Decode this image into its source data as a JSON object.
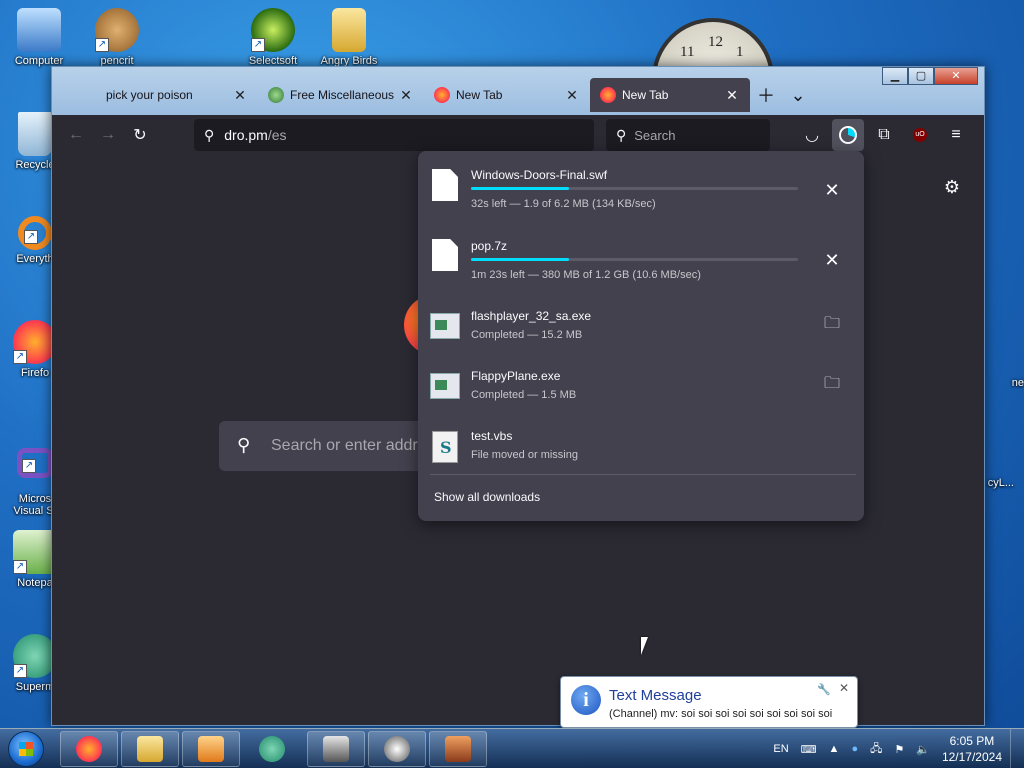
{
  "desktop": {
    "icons": [
      {
        "label": "Computer",
        "icon": "computer-icon",
        "color": "#5aa0e0"
      },
      {
        "label": "Recycle",
        "icon": "recycle-bin-icon",
        "color": "#9fc6e8"
      },
      {
        "label": "Everyth",
        "icon": "everything-search-icon",
        "color": "#f08a20"
      },
      {
        "label": "Firefo",
        "icon": "firefox-icon",
        "color": "#ff6a2a"
      },
      {
        "label": "Micros\nVisual St",
        "icon": "visual-studio-icon",
        "color": "#5a3fa0"
      },
      {
        "label": "Notepa",
        "icon": "notepad-icon",
        "color": "#6ab04a"
      },
      {
        "label": "Superm",
        "icon": "supermium-icon",
        "color": "#2a9a7a"
      },
      {
        "label": "pencrit",
        "icon": "monkey-icon",
        "color": "#b8843c"
      },
      {
        "label": "Selectsoft",
        "icon": "selectsoft-icon",
        "color": "#7ab82a"
      },
      {
        "label": "Angry Birds",
        "icon": "folder-icon",
        "color": "#e8c84a"
      }
    ],
    "right_icons": [
      {
        "label": "ne",
        "icon": "app-icon"
      },
      {
        "label": "cyL...",
        "icon": "app-icon"
      }
    ]
  },
  "browser": {
    "tabs": [
      {
        "title": "pick your poison",
        "favicon": "none",
        "active": false
      },
      {
        "title": "Free Miscellaneous S",
        "favicon": "globe-icon",
        "active": false
      },
      {
        "title": "New Tab",
        "favicon": "firefox-icon",
        "active": false
      },
      {
        "title": "New Tab",
        "favicon": "firefox-icon",
        "active": true
      }
    ],
    "url": {
      "host": "dro.pm",
      "path": "/es"
    },
    "search_placeholder": "Search",
    "newtab_search_placeholder": "Search or enter addres",
    "accent_color": "#00ddff"
  },
  "downloads": {
    "items": [
      {
        "name": "Windows-Doors-Final.swf",
        "status": "32s left — 1.9 of 6.2 MB (134 KB/sec)",
        "progress": 0.3,
        "state": "downloading",
        "icon": "document-icon",
        "action": "cancel-icon"
      },
      {
        "name": "pop.7z",
        "status": "1m 23s left — 380 MB of 1.2 GB (10.6 MB/sec)",
        "progress": 0.3,
        "state": "downloading",
        "icon": "document-icon",
        "action": "cancel-icon"
      },
      {
        "name": "flashplayer_32_sa.exe",
        "status": "Completed — 15.2 MB",
        "progress": 1.0,
        "state": "completed",
        "icon": "exe-icon",
        "action": "folder-icon"
      },
      {
        "name": "FlappyPlane.exe",
        "status": "Completed — 1.5 MB",
        "progress": 1.0,
        "state": "completed",
        "icon": "exe-icon",
        "action": "folder-icon"
      },
      {
        "name": "test.vbs",
        "status": "File moved or missing",
        "progress": 0,
        "state": "missing",
        "icon": "vbs-script-icon",
        "action": "none"
      }
    ],
    "show_all_label": "Show all downloads"
  },
  "notification": {
    "title": "Text Message",
    "body": "(Channel) mv: soi soi soi soi soi soi soi soi soi"
  },
  "taskbar": {
    "apps": [
      "firefox-icon",
      "explorer-folder-icon",
      "media-player-icon",
      "supermium-icon",
      "chess-icon",
      "ble-icon",
      "game-icon"
    ],
    "language": "EN",
    "time": "6:05 PM",
    "date": "12/17/2024"
  }
}
